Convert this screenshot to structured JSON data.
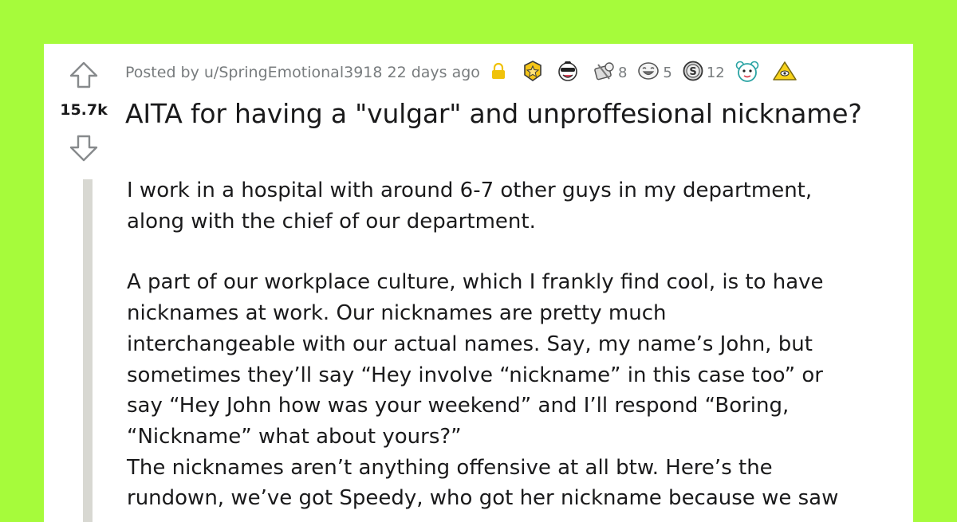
{
  "post": {
    "score": "15.7k",
    "posted_by": "Posted by u/SpringEmotional3918 22 days ago",
    "awards": [
      {
        "icon": "gold-medal-icon",
        "count": ""
      },
      {
        "icon": "wholesome-face-icon",
        "count": ""
      },
      {
        "icon": "gift-hug-icon",
        "count": "8"
      },
      {
        "icon": "laughing-face-icon",
        "count": "5"
      },
      {
        "icon": "silver-coin-icon",
        "count": "12"
      },
      {
        "icon": "bear-face-icon",
        "count": ""
      },
      {
        "icon": "pyramid-award-icon",
        "count": ""
      }
    ],
    "title": "AITA for having a \"vulgar\" and unproffesional nickname?",
    "lines": [
      "I work in a hospital with around 6-7 other guys in my department,",
      "along with the chief of our department.",
      "A part of our workplace culture, which I frankly find cool, is to have",
      "nicknames at work. Our nicknames are pretty much",
      "interchangeable with our actual names. Say, my name’s John, but",
      "sometimes they’ll say “Hey involve “nickname” in this case too” or",
      "say “Hey John how was your weekend” and I’ll respond “Boring,",
      "“Nickname” what about yours?”",
      "The nicknames aren’t anything offensive at all btw. Here’s the",
      "rundown, we’ve got Speedy, who got her nickname because we saw"
    ]
  },
  "colors": {
    "background": "#a6fb3b",
    "card": "#ffffff",
    "text": "#1a1a1b",
    "meta": "#787c7e",
    "quote_bar": "#d8d8d2"
  }
}
